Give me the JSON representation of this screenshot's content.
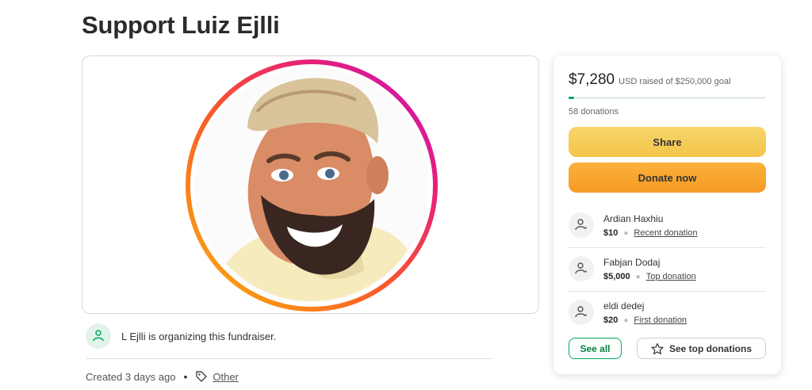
{
  "page": {
    "title": "Support Luiz Ejlli"
  },
  "organizer": {
    "text": "L Ejlli is organizing this fundraiser."
  },
  "meta": {
    "created": "Created 3 days ago",
    "separator": "•",
    "category": "Other"
  },
  "progress": {
    "amount": "$7,280",
    "goal_text": "USD raised of $250,000 goal",
    "donations": "58 donations",
    "fraction": 0.029
  },
  "actions": {
    "share": "Share",
    "donate": "Donate now"
  },
  "donors": [
    {
      "name": "Ardian Haxhiu",
      "amount": "$10",
      "kind": "Recent donation"
    },
    {
      "name": "Fabjan Dodaj",
      "amount": "$5,000",
      "kind": "Top donation"
    },
    {
      "name": "eldi dedej",
      "amount": "$20",
      "kind": "First donation"
    }
  ],
  "footer": {
    "see_all": "See all",
    "see_top": "See top donations"
  },
  "colors": {
    "brand_green": "#02a95c",
    "share_yellow": "#f3c54a",
    "donate_orange": "#f59a24"
  },
  "icons": [
    "person-heart-icon",
    "tag-icon",
    "star-icon"
  ]
}
